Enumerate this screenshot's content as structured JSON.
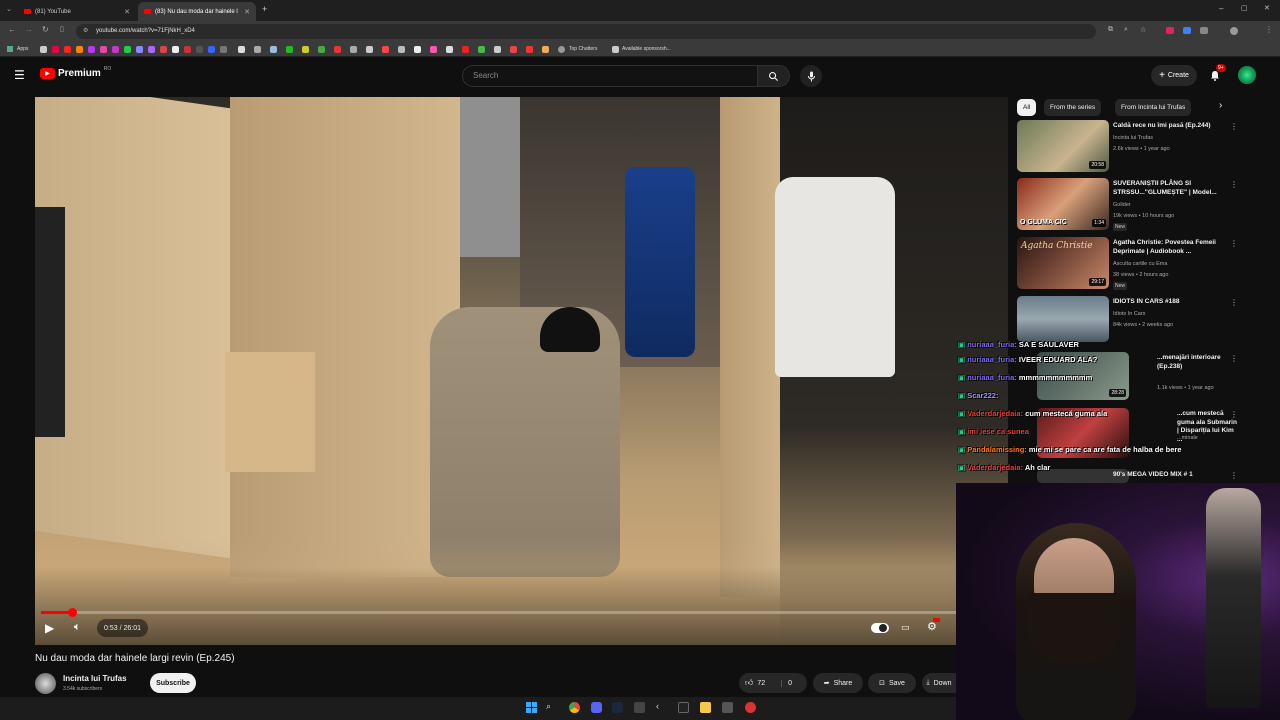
{
  "browser": {
    "tabs": [
      {
        "label": "(81) YouTube"
      },
      {
        "label": "(83) Nu dau moda dar hainele l"
      }
    ],
    "url": "youtube.com/watch?v=71FjNkH_xD4",
    "bookmarks": {
      "apps": "Apps",
      "top_chatters": "Top Chatters",
      "available_sponsors": "Available sponsorsh..."
    }
  },
  "header": {
    "logo": "Premium",
    "logo_region": "RO",
    "search_placeholder": "Search",
    "create_label": "Create",
    "notifications_count": "9+"
  },
  "player": {
    "time": "0:53 / 26:01",
    "progress": 0.034
  },
  "video": {
    "title": "Nu dau moda dar hainele largi revin (Ep.245)",
    "channel": "Incinta lui Trufas",
    "subscribers": "3.54k subscribers",
    "subscribe_label": "Subscribe",
    "likes": "72",
    "dislikes": "0",
    "share_label": "Share",
    "save_label": "Save",
    "download_label": "Down"
  },
  "sidebar": {
    "chips": [
      "All",
      "From the series",
      "From Incinta lui Trufas"
    ],
    "recommendations": [
      {
        "title": "Caldă rece nu îmi pasă (Ep.244)",
        "channel": "Incinta lui Trufas",
        "meta": "2.6k views • 1 year ago",
        "duration": "20:58",
        "badge": ""
      },
      {
        "title": "SUVERANIȘTII PLÂNG SI STRSSU...\"GLUMEȘTE\" | Model...",
        "channel": "Golider",
        "meta": "19k views • 10 hours ago",
        "duration": "1:34",
        "badge": "New"
      },
      {
        "title": "Agatha Christie: Povestea Femeii Deprimate | Audiobook ...",
        "channel": "Asculta cartile cu Ema",
        "meta": "38 views • 2 hours ago",
        "duration": "29:17",
        "badge": "New"
      },
      {
        "title": "IDIOTS IN CARS #188",
        "channel": "Idiots In Cars",
        "meta": "84k views • 2 weeks ago",
        "duration": "",
        "badge": ""
      },
      {
        "title": "...menajări interioare (Ep.238)",
        "channel": "",
        "meta": "1.1k views • 1 year ago",
        "duration": "28:28",
        "badge": ""
      },
      {
        "title": "...cum mestecă guma ala Submarin | Dispariția lui Kim ...",
        "channel": "...minale",
        "meta": "",
        "duration": "",
        "badge": ""
      },
      {
        "title": "90's MEGA VIDEO MIX # 1",
        "channel": "",
        "meta": "",
        "duration": "",
        "badge": ""
      }
    ]
  },
  "chat": [
    {
      "user": "nuriaaa_furia:",
      "text": "SA E SAULAVER",
      "color": "#7b68ee"
    },
    {
      "user": "nuriaaa_furia:",
      "text": "IVEER EDUARD ALA?",
      "color": "#7b68ee"
    },
    {
      "user": "nuriaaa_furia:",
      "text": "mmmmmmmmmmm",
      "color": "#7b68ee"
    },
    {
      "user": "Scar222:",
      "text": "",
      "color": "#7b68ee"
    },
    {
      "user": "Vaderdarjedaia:",
      "text": "cum mestecă guma ala",
      "color": "#e0403a"
    },
    {
      "user": "",
      "text": "imi iese ca sunea",
      "color": "#e0403a"
    },
    {
      "user": "Pandalamissing:",
      "text": "mie mi se pare ca are fata de halba de bere",
      "color": "#ff7a1a"
    },
    {
      "user": "Vaderdarjedaia:",
      "text": "Ah clar",
      "color": "#e0403a"
    }
  ],
  "colors": {
    "accent": "#ff0000",
    "background": "#0f0f0f",
    "chip": "#272727"
  }
}
